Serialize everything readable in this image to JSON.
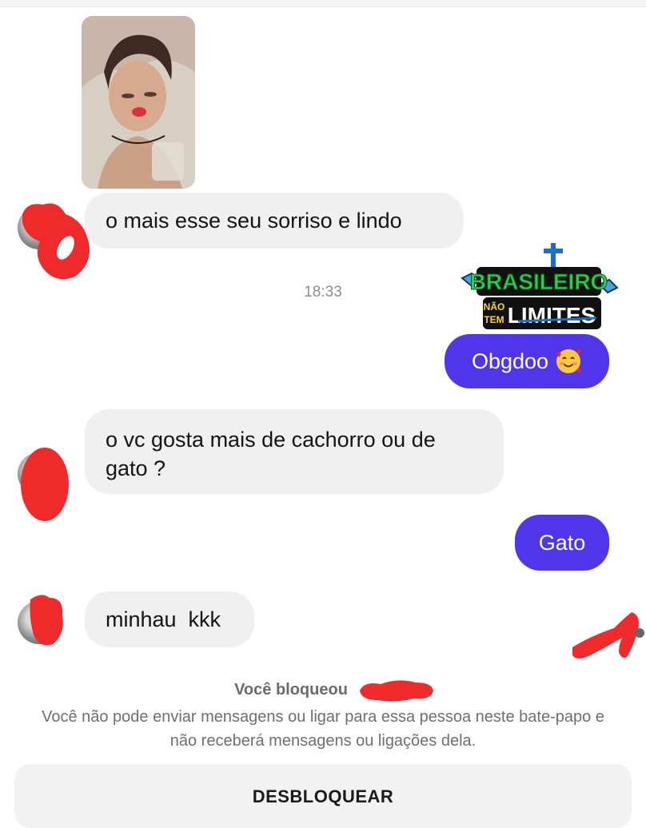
{
  "conversation": {
    "messages": [
      {
        "sender": "contact",
        "type": "photo"
      },
      {
        "sender": "contact",
        "text": "o mais esse seu sorriso e lindo"
      },
      {
        "sender": "me",
        "text": "Obgdoo",
        "emoji": "smiling-face-with-hearts"
      },
      {
        "sender": "contact",
        "text": "o vc gosta mais de cachorro ou de gato ?"
      },
      {
        "sender": "me",
        "text": "Gato"
      },
      {
        "sender": "contact",
        "text": "minhau  kkk"
      }
    ],
    "timestamp": "18:33"
  },
  "watermark": {
    "line1": "BRASILEIRO",
    "line2_small_top": "NÃO",
    "line2_small_bottom": "TEM",
    "line2": "LIMITES"
  },
  "blocked": {
    "title": "Você bloqueou",
    "description": "Você não pode enviar mensagens ou ligar para essa pessoa neste bate-papo e não receberá mensagens ou ligações dela.",
    "unblock_label": "DESBLOQUEAR"
  },
  "colors": {
    "outgoing_bubble": "#5135ea",
    "incoming_bubble": "#f0f0f0",
    "redaction": "#ee2a2a"
  }
}
